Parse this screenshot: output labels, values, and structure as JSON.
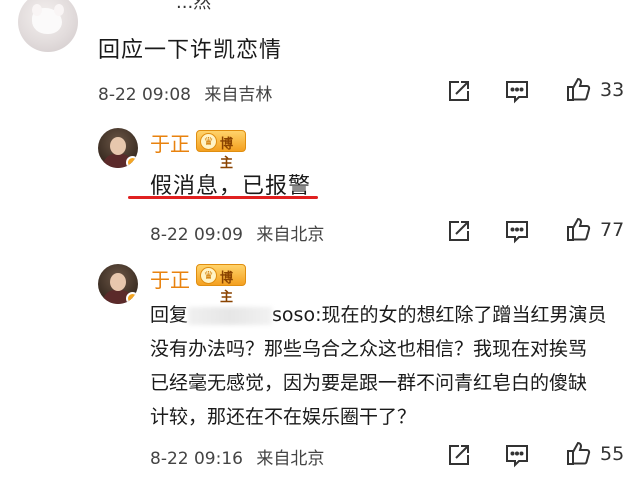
{
  "top_comment": {
    "partial_name": "...然",
    "text": "回应一下许凯恋情",
    "meta": {
      "date_time": "8-22 09:08",
      "location": "来自吉林"
    },
    "likes": "33"
  },
  "reply_1": {
    "username": "于正",
    "badge": "博主",
    "text": "假消息，已报警",
    "meta": {
      "date_time": "8-22 09:09",
      "location": "来自北京"
    },
    "likes": "77"
  },
  "reply_2": {
    "username": "于正",
    "badge": "博主",
    "reply_prefix": "回复",
    "reply_target_suffix": "soso:",
    "lines": [
      "现在的女的想红除了蹭当红男演员",
      "没有办法吗？那些乌合之众这也相信？我现在对挨骂",
      "已经毫无感觉，因为要是跟一群不问青红皂白的傻缺",
      "计较，那还在不在娱乐圈干了？"
    ],
    "meta": {
      "date_time": "8-22 09:16",
      "location": "来自北京"
    },
    "likes": "55"
  },
  "icons": {
    "share": "share-icon",
    "comment": "comment-icon",
    "like": "thumbs-up-icon"
  },
  "colors": {
    "username": "#e8820e",
    "underline": "#e02020",
    "badge": "#f4a020"
  }
}
